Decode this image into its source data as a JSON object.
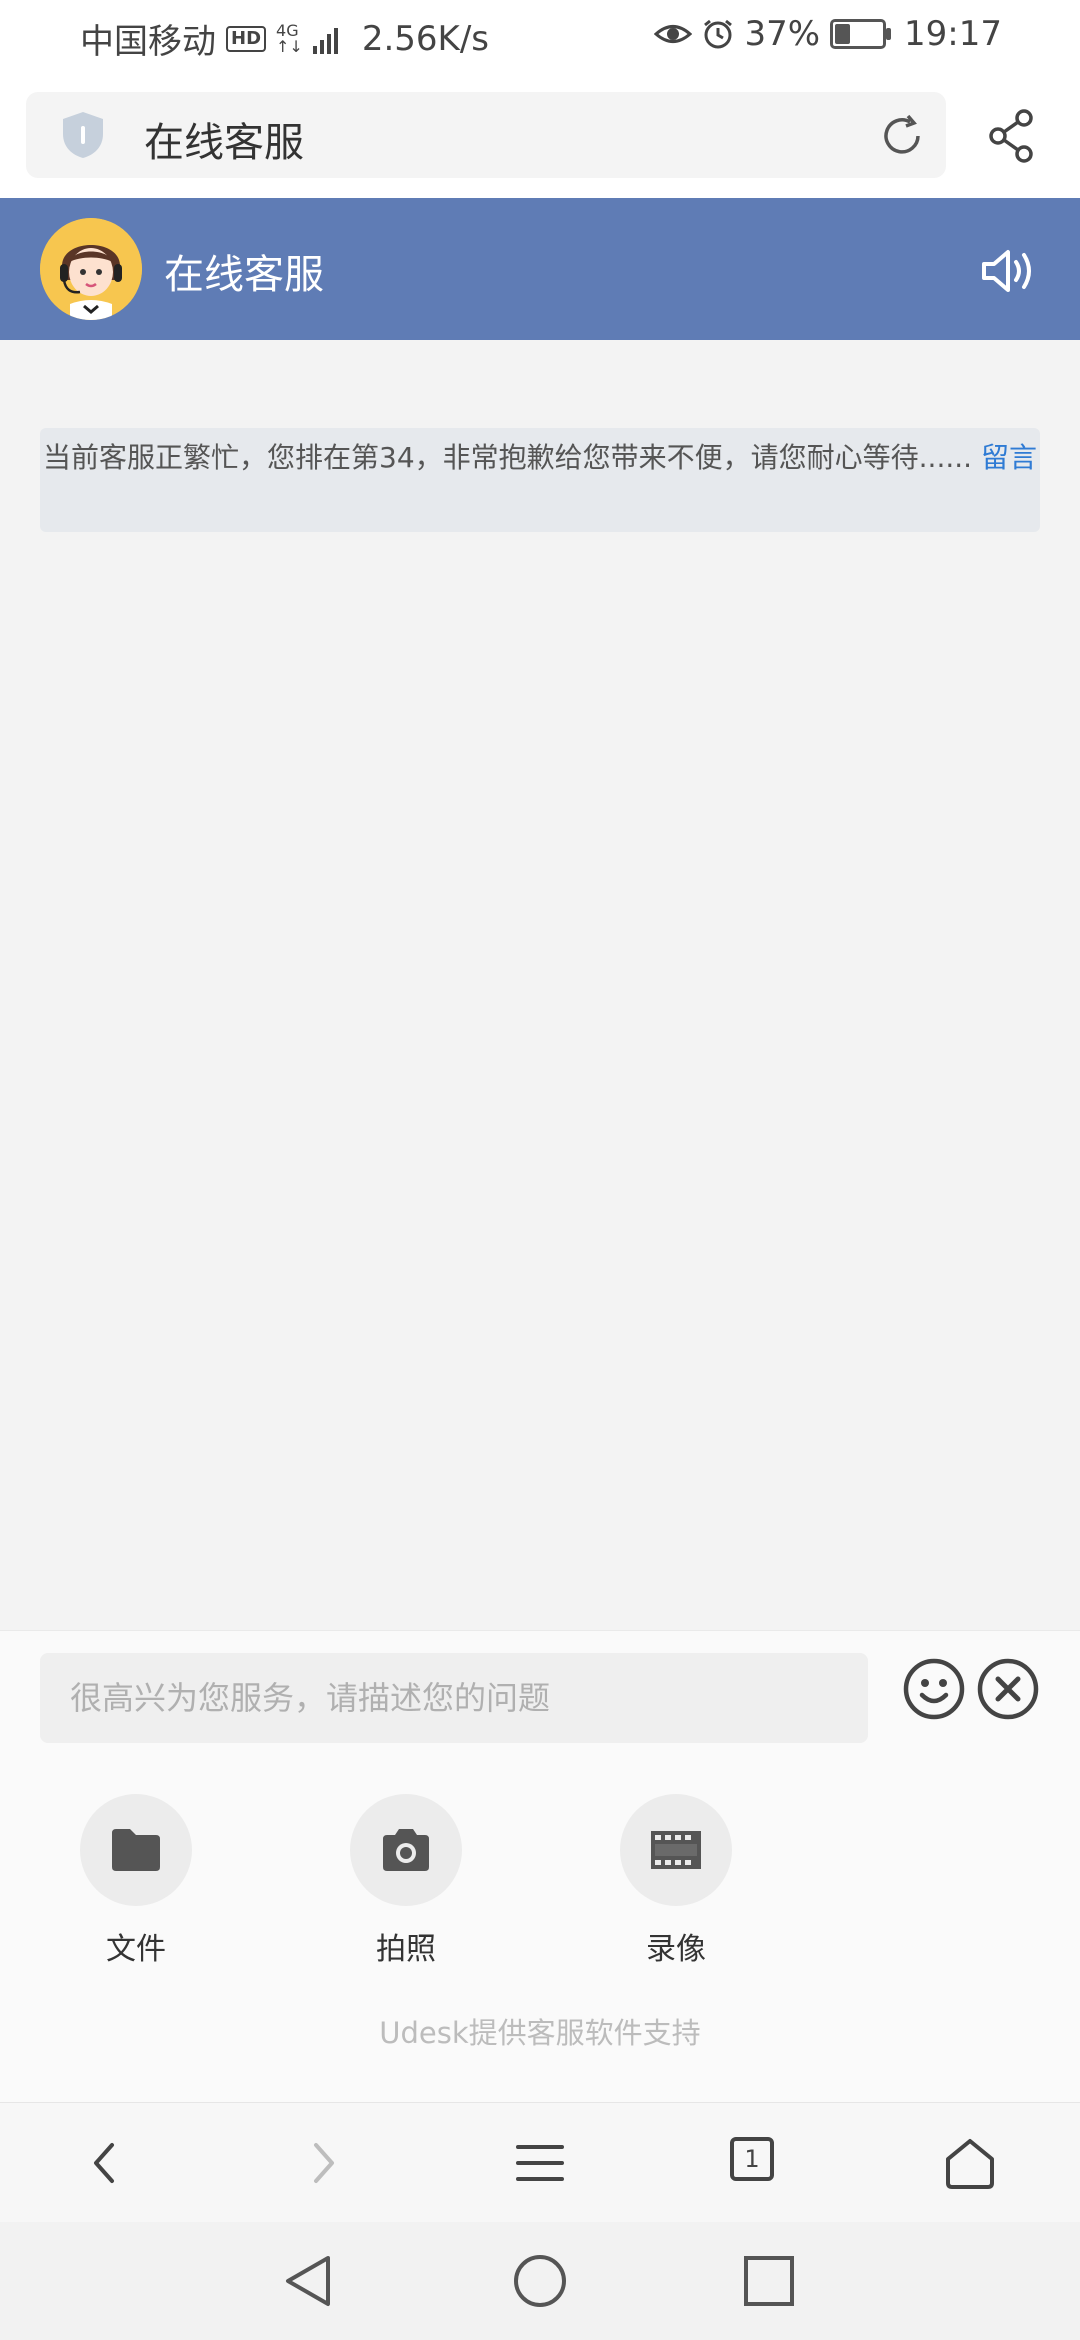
{
  "status_bar": {
    "carrier": "中国移动",
    "hd_badge": "HD",
    "network_top": "4G",
    "network_bottom": "↑↓",
    "speed": "2.56K/s",
    "battery_percent": "37%",
    "time": "19:17",
    "battery_level": 0.37
  },
  "browser": {
    "address_text": "在线客服",
    "shield_icon": "shield-icon",
    "refresh_icon": "refresh-icon",
    "share_icon": "share-icon"
  },
  "chat": {
    "title": "在线客服",
    "header_color": "#5f7cb5",
    "notice_text": "当前客服正繁忙，您排在第34，非常抱歉给您带来不便，请您耐心等待......",
    "notice_link": "留言",
    "link_color": "#2f7bd4"
  },
  "input": {
    "placeholder": "很高兴为您服务，请描述您的问题"
  },
  "tools": [
    {
      "label": "文件",
      "icon": "folder-icon"
    },
    {
      "label": "拍照",
      "icon": "camera-icon"
    },
    {
      "label": "录像",
      "icon": "film-icon"
    }
  ],
  "powered_by": "Udesk提供客服软件支持",
  "browser_nav": {
    "tab_count": "1"
  }
}
